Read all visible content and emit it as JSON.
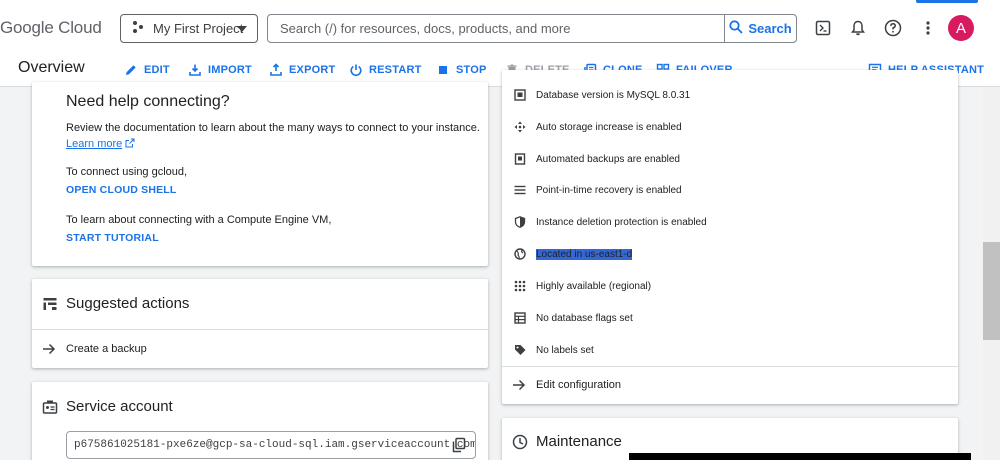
{
  "header": {
    "logo_google": "Google",
    "logo_cloud": "Cloud",
    "project_name": "My First Project",
    "search_placeholder": "Search (/) for resources, docs, products, and more",
    "search_button": "Search",
    "avatar_letter": "A"
  },
  "toolbar": {
    "title": "Overview",
    "edit": "EDIT",
    "import": "IMPORT",
    "export": "EXPORT",
    "restart": "RESTART",
    "stop": "STOP",
    "delete": "DELETE",
    "clone": "CLONE",
    "failover": "FAILOVER",
    "help_assistant": "HELP ASSISTANT"
  },
  "help_card": {
    "title": "Need help connecting?",
    "review_text": "Review the documentation to learn about the many ways to connect to your instance.",
    "learn_more": "Learn more",
    "gcloud_text": "To connect using gcloud,",
    "open_shell": "OPEN CLOUD SHELL",
    "vm_text": "To learn about connecting with a Compute Engine VM,",
    "start_tutorial": "START TUTORIAL"
  },
  "suggested": {
    "title": "Suggested actions",
    "item": "Create a backup"
  },
  "service_account": {
    "title": "Service account",
    "value": "p675861025181-pxe6ze@gcp-sa-cloud-sql.iam.gserviceaccount.com"
  },
  "config": {
    "items": [
      "Database version is MySQL 8.0.31",
      "Auto storage increase is enabled",
      "Automated backups are enabled",
      "Point-in-time recovery is enabled",
      "Instance deletion protection is enabled",
      "Located in us-east1-d",
      "Highly available (regional)",
      "No database flags set",
      "No labels set"
    ],
    "edit_configuration": "Edit configuration"
  },
  "maintenance": {
    "title": "Maintenance"
  },
  "colors": {
    "accent": "#1a73e8",
    "avatar": "#d81b60",
    "selection": "#3367d6"
  },
  "icons": {
    "project": "project-dots-icon",
    "search": "search-icon",
    "shell": "cloud-shell-icon",
    "notifications": "bell-icon",
    "help": "help-icon",
    "more": "more-vert-icon"
  }
}
